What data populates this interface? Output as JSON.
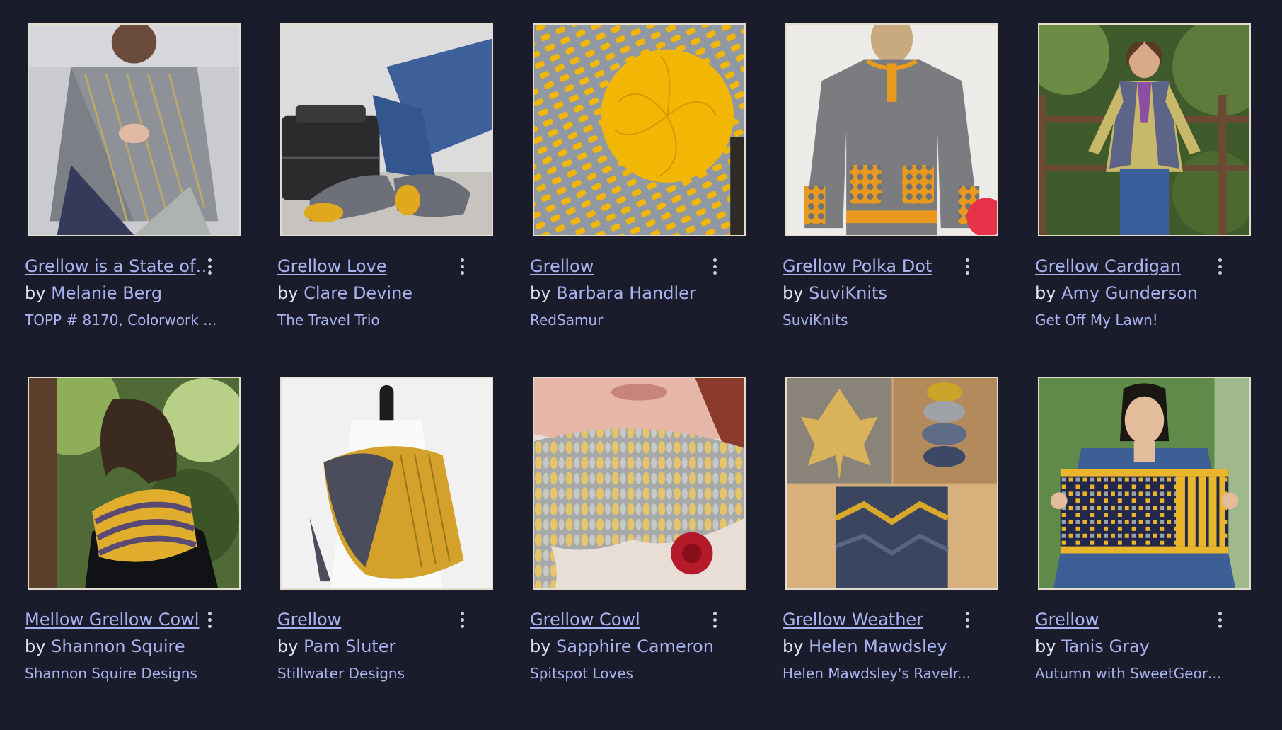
{
  "colors": {
    "background": "#1b1c2b",
    "link": "#a9b3ef",
    "text": "#e2e4ef",
    "accent_yellow": "#f2b705",
    "gray_yarn": "#7d828c"
  },
  "by_prefix": "by ",
  "menu_icon": "more-vertical-icon",
  "patterns": [
    {
      "title": "Grellow is a State of ...",
      "author": "Melanie Berg",
      "source": "TOPP # 8170, Colorwork ...",
      "image": "shawl-photo"
    },
    {
      "title": "Grellow Love",
      "author": "Clare Devine",
      "source": "The Travel Trio",
      "image": "socks-photo"
    },
    {
      "title": "Grellow",
      "author": "Barbara Handler",
      "source": "RedSamur",
      "image": "hat-photo"
    },
    {
      "title": "Grellow Polka Dot",
      "author": "SuviKnits",
      "source": "SuviKnits",
      "image": "sweater-photo"
    },
    {
      "title": "Grellow Cardigan",
      "author": "Amy Gunderson",
      "source": "Get Off My Lawn!",
      "image": "cardigan-photo"
    },
    {
      "title": "Mellow Grellow Cowl",
      "author": "Shannon Squire",
      "source": "Shannon Squire Designs",
      "image": "cowl-photo"
    },
    {
      "title": "Grellow",
      "author": "Pam Sluter",
      "source": "Stillwater Designs",
      "image": "wrap-photo"
    },
    {
      "title": "Grellow Cowl",
      "author": "Sapphire Cameron",
      "source": "Spitspot Loves",
      "image": "chunky-cowl-photo"
    },
    {
      "title": "Grellow Weather",
      "author": "Helen Mawdsley",
      "source": "Helen Mawdsley's Ravelr...",
      "image": "collage-photo"
    },
    {
      "title": "Grellow",
      "author": "Tanis Gray",
      "source": "Autumn with SweetGeorg...",
      "image": "scarf-photo"
    }
  ]
}
